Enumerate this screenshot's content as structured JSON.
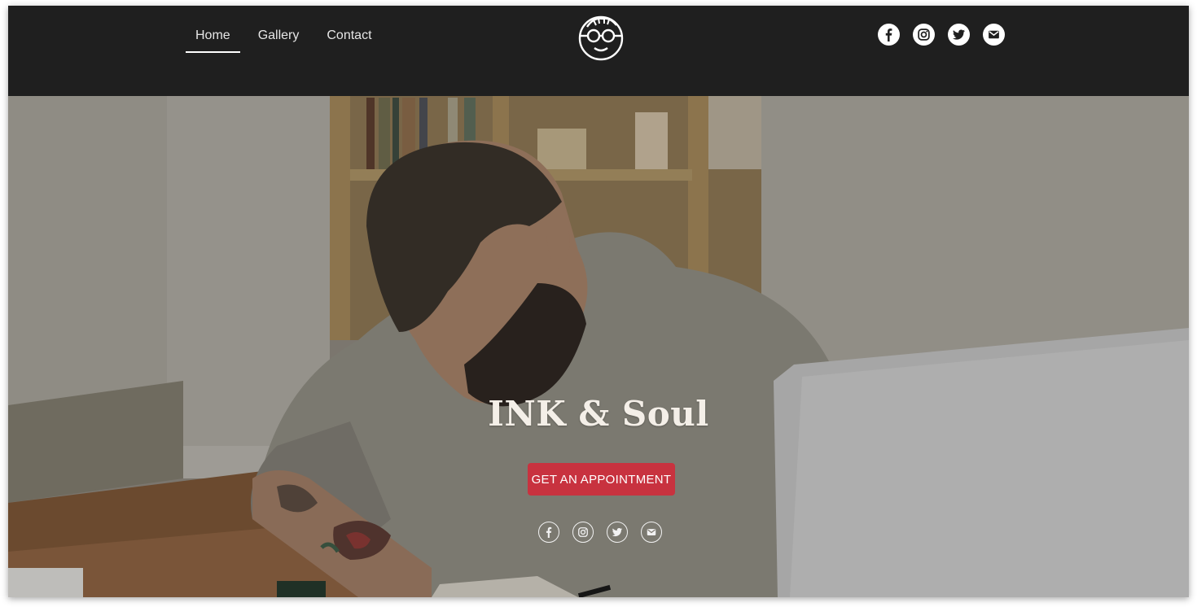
{
  "nav": {
    "links": [
      {
        "label": "Home",
        "active": true
      },
      {
        "label": "Gallery",
        "active": false
      },
      {
        "label": "Contact",
        "active": false
      }
    ],
    "logo_icon": "face-with-glasses-logo",
    "social_icons": [
      "facebook-icon",
      "instagram-icon",
      "twitter-icon",
      "email-icon"
    ]
  },
  "hero": {
    "title": "INK & Soul",
    "cta_label": "GET AN APPOINTMENT",
    "social_icons": [
      "facebook-icon",
      "instagram-icon",
      "twitter-icon",
      "email-icon"
    ],
    "background": "photo-tattooed-man-drawing-at-desk"
  },
  "colors": {
    "navbar": "#1f1f1f",
    "nav_text": "#e6e6e6",
    "accent_button": "#c8323f",
    "hero_text": "#f4efe8"
  }
}
